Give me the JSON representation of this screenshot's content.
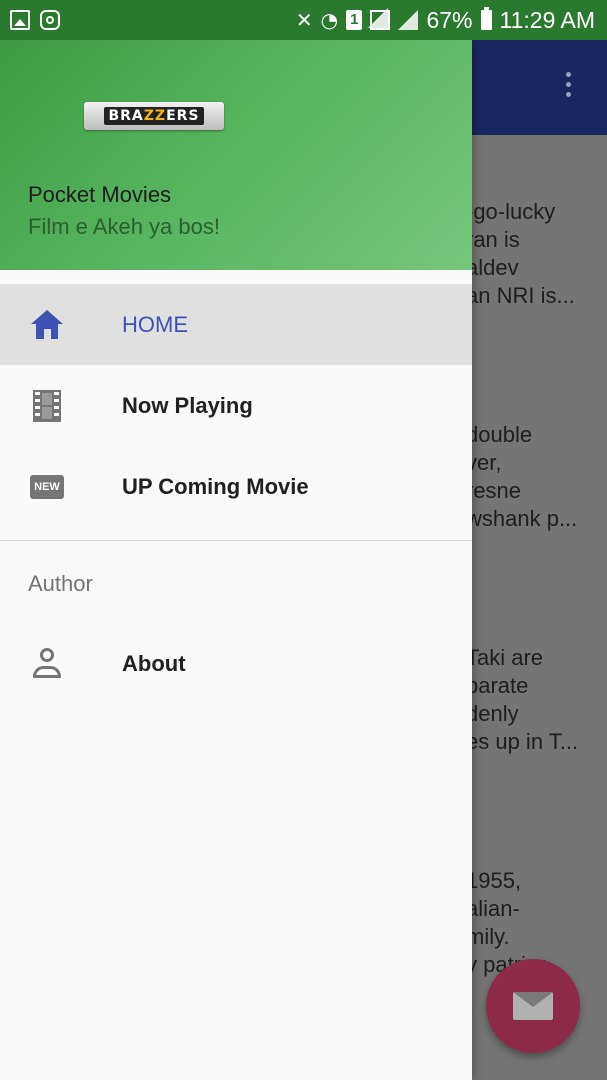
{
  "status_bar": {
    "battery_percent": "67%",
    "time": "11:29 AM",
    "sim_label": "1"
  },
  "drawer": {
    "header": {
      "logo_text": {
        "pre": "BRA",
        "mid": "ZZ",
        "post": "ERS"
      },
      "title": "Pocket Movies",
      "subtitle": "Film e Akeh ya bos!"
    },
    "items": [
      {
        "label": "HOME",
        "icon": "home-icon",
        "active": true
      },
      {
        "label": "Now Playing",
        "icon": "film-icon",
        "active": false
      },
      {
        "label": "UP Coming Movie",
        "icon": "new-badge-icon",
        "badge_text": "NEW",
        "active": false
      }
    ],
    "section_title": "Author",
    "section_items": [
      {
        "label": "About",
        "icon": "person-icon"
      }
    ]
  },
  "background": {
    "snippets": [
      [
        "-go-lucky",
        "ran is",
        "aldev",
        "an NRI is..."
      ],
      [
        "double",
        "ver,",
        "resne",
        "wshank p..."
      ],
      [
        "Taki are",
        "parate",
        "denly",
        "es up in T..."
      ],
      [
        "1955,",
        "alian-",
        "mily.",
        "y patriar..."
      ]
    ]
  },
  "colors": {
    "accent": "#3f51b5",
    "header_gradient_start": "#3d9c41",
    "header_gradient_end": "#78c67c",
    "status_bar": "#2a7a2e",
    "fab": "#8c2a48"
  }
}
